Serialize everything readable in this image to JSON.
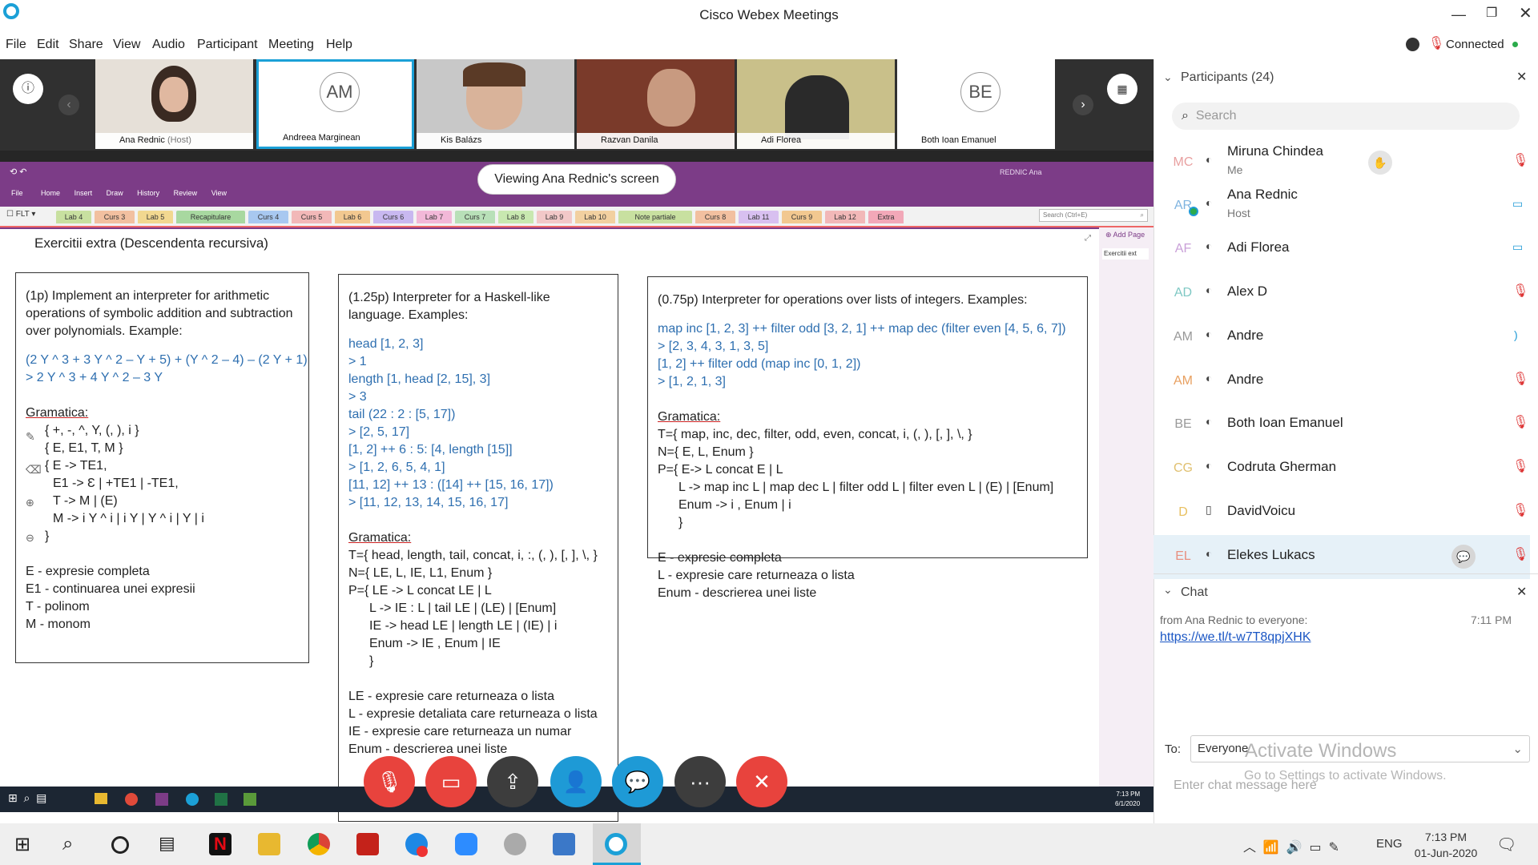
{
  "window": {
    "title": "Cisco Webex Meetings",
    "status": "Connected"
  },
  "menu": [
    "File",
    "Edit",
    "Share",
    "View",
    "Audio",
    "Participant",
    "Meeting",
    "Help"
  ],
  "videos": [
    {
      "name": "Ana Rednic",
      "role": "(Host)"
    },
    {
      "name": "Andreea Marginean",
      "initials": "AM"
    },
    {
      "name": "Kis Balázs"
    },
    {
      "name": "Razvan Danila"
    },
    {
      "name": "Adi Florea"
    },
    {
      "name": "Both Ioan Emanuel",
      "initials": "BE"
    }
  ],
  "share": {
    "banner": "Viewing Ana Rednic's screen",
    "onenote_menu": [
      "File",
      "Home",
      "Insert",
      "Draw",
      "History",
      "Review",
      "View"
    ],
    "notebook": "FLT",
    "account": "REDNIC Ana",
    "search_placeholder": "Search (Ctrl+E)",
    "tabs": [
      "Lab 4",
      "Curs 3",
      "Lab 5",
      "Recapitulare",
      "Curs 4",
      "Curs 5",
      "Lab 6",
      "Curs 6",
      "Lab 7",
      "Curs 7",
      "Lab 8",
      "Lab 9",
      "Lab 10",
      "Note partiale",
      "Curs 8",
      "Lab 11",
      "Curs 9",
      "Lab 12",
      "Extra"
    ],
    "page_title": "Exercitii extra (Descendenta recursiva)",
    "add_page": "Add Page",
    "page_item": "Exercitii ext",
    "clock_time": "7:13 PM",
    "clock_date": "6/1/2020",
    "box1": {
      "intro": "(1p) Implement an interpreter for arithmetic operations of symbolic addition and subtraction over polynomials. Example:",
      "ex_in": "(2 Y ^ 3 + 3 Y ^ 2 – Y + 5) + (Y ^ 2 – 4) – (2 Y + 1)",
      "ex_out": "> 2 Y ^ 3 + 4 Y ^ 2 – 3 Y",
      "gram": "Gramatica:",
      "g1": "{ +, -, ^, Y, (, ), i }",
      "g2": "{ E, E1, T, M }",
      "g3": "{ E -> TE1,",
      "g4": "E1 -> Ɛ | +TE1 | -TE1,",
      "g5": "T -> M | (E)",
      "g6": "M -> i Y ^ i | i Y | Y ^ i | Y | i",
      "g7": "}",
      "d1": "E - expresie completa",
      "d2": "E1 - continuarea unei expresii",
      "d3": "T - polinom",
      "d4": "M - monom"
    },
    "box2": {
      "intro": "(1.25p) Interpreter for a Haskell-like language. Examples:",
      "ex": [
        "head [1, 2, 3]",
        "> 1",
        "length [1, head [2, 15], 3]",
        "> 3",
        "tail (22 : 2 : [5, 17])",
        "> [2, 5, 17]",
        "[1, 2] ++ 6 : 5: [4, length [15]]",
        "> [1, 2, 6, 5, 4, 1]",
        "[11, 12] ++ 13 : ([14] ++ [15, 16, 17])",
        "> [11, 12, 13, 14, 15, 16, 17]"
      ],
      "gram": "Gramatica:",
      "g": [
        "T={ head, length, tail, concat, i, :, (, ), [, ], \\, }",
        "N={ LE, L, IE, L1, Enum }",
        "P={ LE -> L concat LE | L",
        "L -> IE : L | tail LE | (LE) | [Enum]",
        "IE -> head LE | length LE | (IE) | i",
        "Enum -> IE , Enum | IE",
        "}"
      ],
      "d": [
        "LE - expresie care returneaza o lista",
        "L - expresie detaliata care returneaza o lista",
        "IE - expresie care returneaza un numar",
        "Enum - descrierea unei liste"
      ]
    },
    "box3": {
      "intro": "(0.75p) Interpreter for operations over lists of integers. Examples:",
      "ex": [
        "map inc [1, 2, 3] ++ filter odd [3, 2, 1] ++ map dec (filter even [4, 5, 6, 7])",
        "> [2, 3, 4, 3, 1, 3, 5]",
        "[1, 2] ++ filter odd (map inc [0, 1, 2])",
        "> [1, 2, 1, 3]"
      ],
      "gram": "Gramatica:",
      "g": [
        "T={ map, inc, dec, filter, odd, even, concat, i, (, ), [, ], \\, }",
        "N={ E, L, Enum }",
        "P={ E-> L concat E | L",
        "L -> map inc L | map dec L | filter odd L | filter even L | (E) | [Enum]",
        "Enum -> i , Enum | i",
        "}"
      ],
      "d": [
        "E - expresie completa",
        "L - expresie care returneaza o lista",
        "Enum - descrierea unei liste"
      ]
    }
  },
  "participants": {
    "header": "Participants (24)",
    "search_placeholder": "Search",
    "list": [
      {
        "initials": "MC",
        "name": "Miruna Chindea",
        "sub": "Me",
        "color": "#e8a0a0"
      },
      {
        "initials": "AR",
        "name": "Ana Rednic",
        "sub": "Host",
        "color": "#7fb4e0"
      },
      {
        "initials": "AF",
        "name": "Adi Florea",
        "color": "#c9a0d8"
      },
      {
        "initials": "AD",
        "name": "Alex D",
        "color": "#7fc8c4"
      },
      {
        "initials": "AM",
        "name": "Andre",
        "color": "#999999"
      },
      {
        "initials": "AM",
        "name": "Andre",
        "color": "#e8a060"
      },
      {
        "initials": "BE",
        "name": "Both Ioan Emanuel",
        "color": "#999999"
      },
      {
        "initials": "CG",
        "name": "Codruta Gherman",
        "color": "#e0c070"
      },
      {
        "initials": "D",
        "name": "DavidVoicu",
        "color": "#e8c060"
      },
      {
        "initials": "EL",
        "name": "Elekes Lukacs",
        "color": "#e89080"
      }
    ]
  },
  "chat": {
    "header": "Chat",
    "from": "from Ana Rednic to everyone:",
    "time": "7:11 PM",
    "link": "https://we.tl/t-w7T8qpjXHK",
    "to_label": "To:",
    "to_value": "Everyone",
    "placeholder": "Enter chat message here",
    "activate1": "Activate Windows",
    "activate2": "Go to Settings to activate Windows."
  },
  "taskbar": {
    "lang": "ENG",
    "time": "7:13 PM",
    "date": "01-Jun-2020"
  }
}
